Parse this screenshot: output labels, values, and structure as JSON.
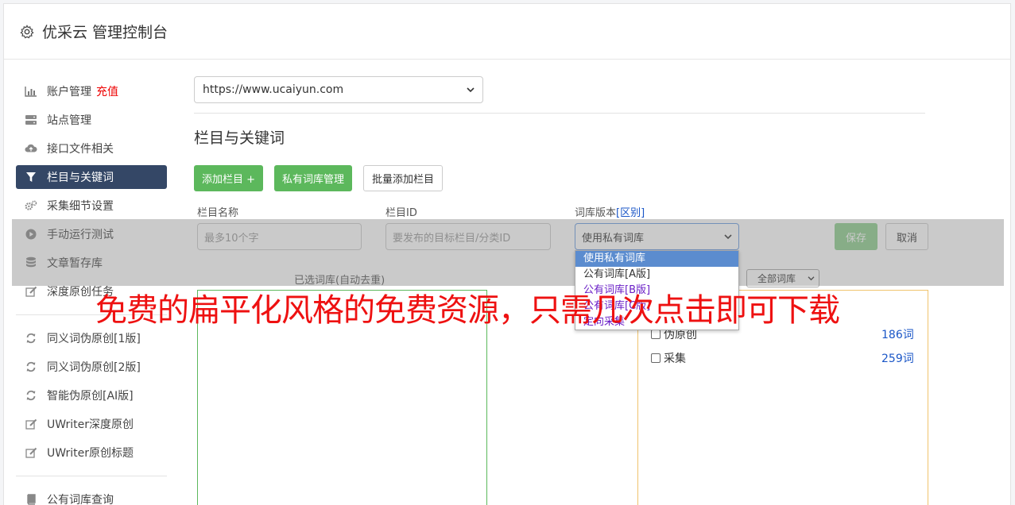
{
  "app": {
    "title": "优采云 管理控制台"
  },
  "sidebar": {
    "items": [
      {
        "label": "账户管理",
        "badge": "充值",
        "icon": "bar-chart-icon"
      },
      {
        "label": "站点管理",
        "icon": "server-icon"
      },
      {
        "label": "接口文件相关",
        "icon": "cloud-upload-icon"
      },
      {
        "label": "栏目与关键词",
        "icon": "filter-icon",
        "active": true
      },
      {
        "label": "采集细节设置",
        "icon": "cogs-icon"
      },
      {
        "label": "手动运行测试",
        "icon": "play-icon"
      },
      {
        "label": "文章暂存库",
        "icon": "database-icon"
      },
      {
        "label": "深度原创任务",
        "icon": "edit-icon"
      }
    ],
    "items2": [
      {
        "label": "同义词伪原创[1版]",
        "icon": "refresh-icon"
      },
      {
        "label": "同义词伪原创[2版]",
        "icon": "refresh-icon"
      },
      {
        "label": "智能伪原创[AI版]",
        "icon": "refresh-icon"
      },
      {
        "label": "UWriter深度原创",
        "icon": "edit-icon"
      },
      {
        "label": "UWriter原创标题",
        "icon": "edit-icon"
      }
    ],
    "items3": [
      {
        "label": "公有词库查询",
        "icon": "book-icon"
      }
    ]
  },
  "main": {
    "site_url": "https://www.ucaiyun.com",
    "section_title": "栏目与关键词",
    "buttons": {
      "add": "添加栏目 +",
      "private": "私有词库管理",
      "batch": "批量添加栏目"
    },
    "form": {
      "name_label": "栏目名称",
      "name_placeholder": "最多10个字",
      "id_label": "栏目ID",
      "id_placeholder": "要发布的目标栏目/分类ID",
      "version_label": "词库版本",
      "version_diff": "[区别]",
      "version_value": "使用私有词库",
      "save": "保存",
      "cancel": "取消"
    },
    "dropdown_options": [
      "使用私有词库",
      "公有词库[A版]",
      "公有词库[B版]",
      "公有词库[C版]",
      "定向采集"
    ],
    "selected_title": "已选词库(自动去重)",
    "filter_value": "全部词库",
    "words": [
      {
        "label": "伪原创",
        "count": "186词"
      },
      {
        "label": "采集",
        "count": "259词"
      }
    ]
  },
  "banner": "免费的扁平化风格的免费资源，只需几次点击即可下载"
}
